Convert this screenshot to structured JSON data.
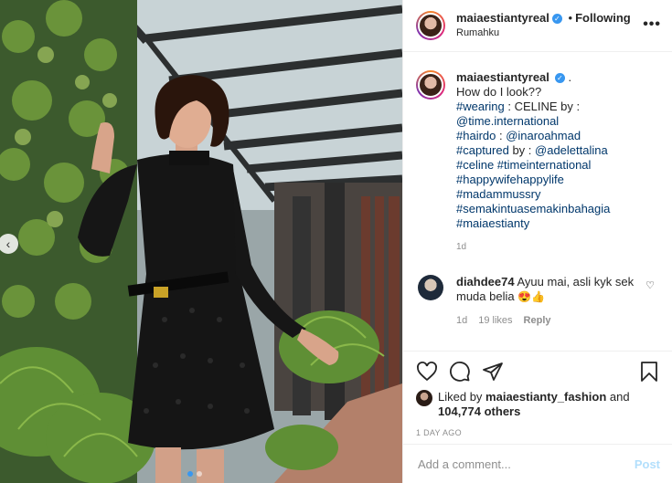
{
  "post": {
    "username": "maiaestiantyreal",
    "follow_separator": "•",
    "follow_status": "Following",
    "location": "Rumahku",
    "more_label": "•••"
  },
  "caption": {
    "username": "maiaestiantyreal",
    "trailing": ".",
    "line1": "How do I look??",
    "wearing_tag": "#wearing",
    "wearing_text": " : CELINE by :",
    "mention_time": "@time.international",
    "hairdo_tag": "#hairdo",
    "hairdo_sep": " : ",
    "hairdo_mention": "@inaroahmad",
    "captured_tag": "#captured",
    "captured_sep": " by : ",
    "captured_mention": "@adelettalina",
    "tags_line1": "#celine #timeinternational",
    "tags_line2": "#happywifehappylife",
    "tags_line3": "#madammussry",
    "tags_line4": "#semakintuasemakinbahagia",
    "tags_line5": "#maiaestianty",
    "time": "1d"
  },
  "comment": {
    "username": "diahdee74",
    "text": "Ayuu mai, asli kyk sek muda belia",
    "emojis": "😍👍",
    "time": "1d",
    "likes": "19 likes",
    "reply": "Reply"
  },
  "likes": {
    "prefix": "Liked by",
    "user": "maiaestianty_fashion",
    "and": "and",
    "count": "104,774 others"
  },
  "timestamp": "1 DAY AGO",
  "add_comment": {
    "placeholder": "Add a comment...",
    "post_label": "Post"
  },
  "icons": {
    "like": "heart-icon",
    "comment": "comment-icon",
    "share": "share-icon",
    "save": "bookmark-icon",
    "verified": "verified-badge-icon",
    "prev": "chevron-left-icon"
  },
  "carousel": {
    "total": 2,
    "active": 1
  },
  "colors": {
    "link": "#00376b",
    "verified": "#3897f0",
    "muted": "#8e8e8e",
    "post_disabled": "#b2dffc"
  }
}
